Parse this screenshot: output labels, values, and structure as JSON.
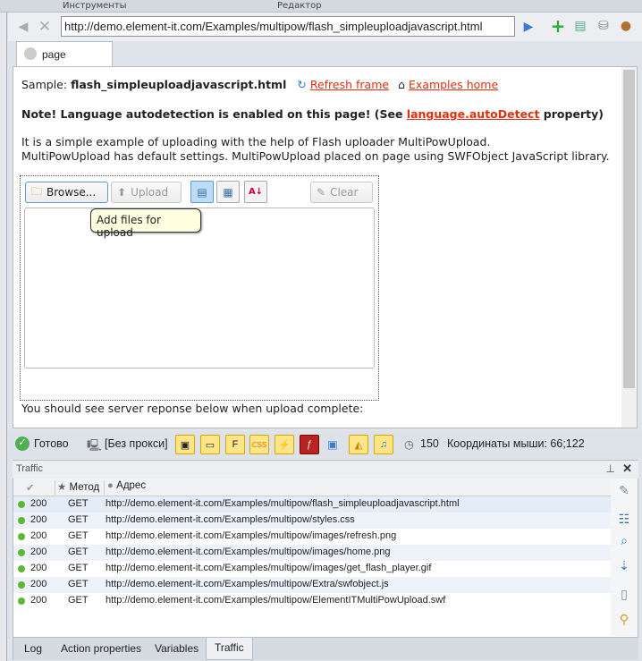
{
  "top_tabs": [
    "Инструменты",
    "Редактор"
  ],
  "address_bar": {
    "url": "http://demo.element-it.com/Examples/multipow/flash_simpleuploadjavascript.html"
  },
  "page_tab": {
    "label": "page"
  },
  "content": {
    "sample_label": "Sample: ",
    "sample_file": "flash_simpleuploadjavascript.html",
    "refresh_link": "Refresh frame",
    "home_link": "Examples home",
    "note_prefix": "Note! Language autodetection is enabled on this page! (See ",
    "note_link": "language.autoDetect",
    "note_suffix": " property)",
    "desc1": "It is a simple example of uploading with the help of  Flash uploader MultiPowUpload.",
    "desc2": "MultiPowUpload has default settings. MultiPowUpload placed on page using SWFObject JavaScript library.",
    "browse": "Browse...",
    "upload": "Upload",
    "clear": "Clear",
    "tooltip": "Add files for upload",
    "server_note": "You should see server reponse below when upload complete:"
  },
  "status": {
    "ready": "Готово",
    "proxy": "[Без прокси]",
    "timer": "150",
    "mouse": "Координаты мыши: 66;122"
  },
  "traffic": {
    "title": "Traffic",
    "columns": [
      "Метод",
      "Адрес"
    ],
    "rows": [
      {
        "code": "200",
        "method": "GET",
        "url": "http://demo.element-it.com/Examples/multipow/flash_simpleuploadjavascript.html"
      },
      {
        "code": "200",
        "method": "GET",
        "url": "http://demo.element-it.com/Examples/multipow/styles.css"
      },
      {
        "code": "200",
        "method": "GET",
        "url": "http://demo.element-it.com/Examples/multipow/images/refresh.png"
      },
      {
        "code": "200",
        "method": "GET",
        "url": "http://demo.element-it.com/Examples/multipow/images/home.png"
      },
      {
        "code": "200",
        "method": "GET",
        "url": "http://demo.element-it.com/Examples/multipow/images/get_flash_player.gif"
      },
      {
        "code": "200",
        "method": "GET",
        "url": "http://demo.element-it.com/Examples/multipow/Extra/swfobject.js"
      },
      {
        "code": "200",
        "method": "GET",
        "url": "http://demo.element-it.com/Examples/multipow/ElementITMultiPowUpload.swf"
      }
    ]
  },
  "bottom_tabs": [
    "Log",
    "Action properties",
    "Variables",
    "Traffic"
  ]
}
